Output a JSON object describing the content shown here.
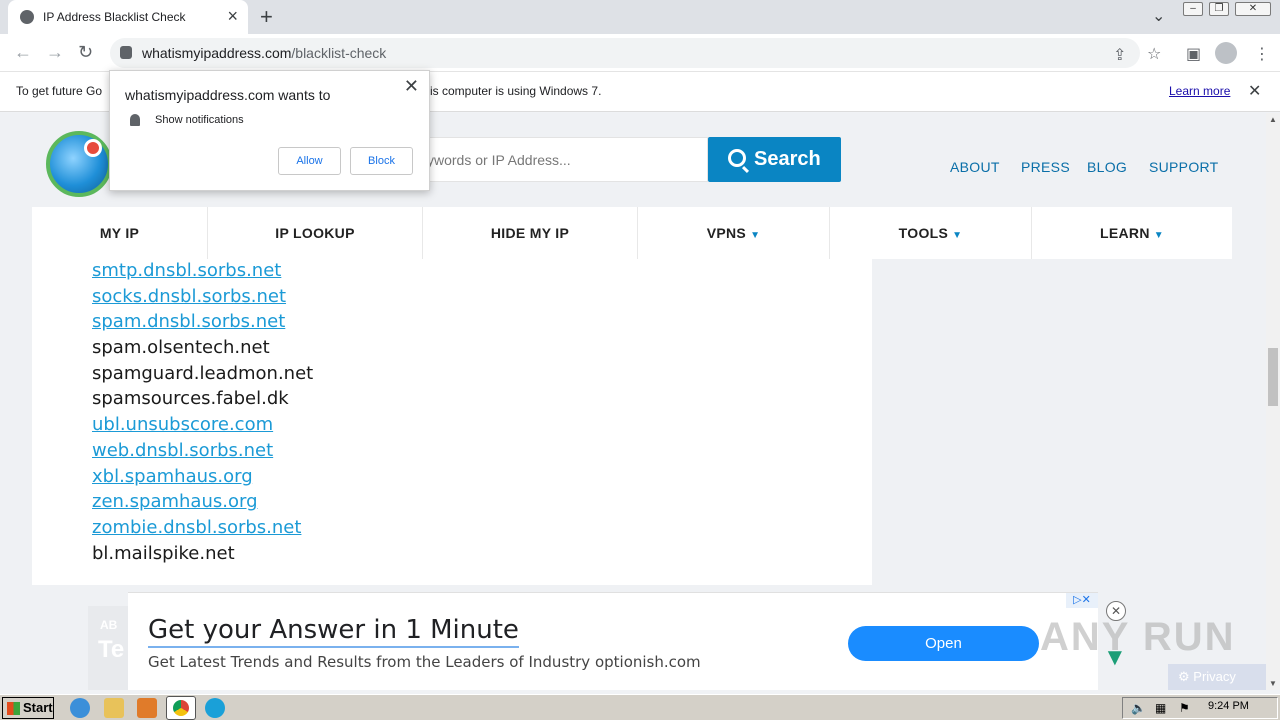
{
  "tab": {
    "title": "IP Address Blacklist Check",
    "favicon_icon": "globe-icon"
  },
  "address_bar": {
    "domain": "whatismyipaddress.com",
    "path": "/blacklist-check"
  },
  "infobar": {
    "message_left": "To get future Go",
    "message_right": "is computer is using Windows 7.",
    "learn_more": "Learn more"
  },
  "notification_prompt": {
    "heading": "whatismyipaddress.com wants to",
    "permission": "Show notifications",
    "allow": "Allow",
    "block": "Block"
  },
  "site": {
    "search_placeholder": "ywords or IP Address...",
    "search_button": "Search",
    "top_links": [
      "ABOUT",
      "PRESS",
      "BLOG",
      "SUPPORT"
    ],
    "nav": [
      {
        "label": "MY IP",
        "caret": ""
      },
      {
        "label": "IP LOOKUP",
        "caret": ""
      },
      {
        "label": "HIDE MY IP",
        "caret": ""
      },
      {
        "label": "VPNS",
        "caret": "▼"
      },
      {
        "label": "TOOLS",
        "caret": "▼"
      },
      {
        "label": "LEARN",
        "caret": "▼"
      }
    ],
    "blacklists": [
      {
        "name": "smtp.dnsbl.sorbs.net",
        "link": true
      },
      {
        "name": "socks.dnsbl.sorbs.net",
        "link": true
      },
      {
        "name": "spam.dnsbl.sorbs.net",
        "link": true
      },
      {
        "name": "spam.olsentech.net",
        "link": false
      },
      {
        "name": "spamguard.leadmon.net",
        "link": false
      },
      {
        "name": "spamsources.fabel.dk",
        "link": false
      },
      {
        "name": "ubl.unsubscore.com",
        "link": true
      },
      {
        "name": "web.dnsbl.sorbs.net",
        "link": true
      },
      {
        "name": "xbl.spamhaus.org",
        "link": true
      },
      {
        "name": "zen.spamhaus.org",
        "link": true
      },
      {
        "name": "zombie.dnsbl.sorbs.net",
        "link": true
      },
      {
        "name": "bl.mailspike.net",
        "link": false
      }
    ]
  },
  "ad": {
    "headline": "Get your Answer in 1 Minute",
    "subtext": "Get Latest Trends and Results from the Leaders of Industry optionish.com",
    "cta": "Open",
    "side_text_1": "AB",
    "side_text_2": "Te",
    "privacy": "Privacy",
    "adchoices": "▷✕"
  },
  "watermark": "ANY RUN",
  "taskbar": {
    "start": "Start",
    "clock": "9:24 PM"
  },
  "colors": {
    "brand_blue": "#0a85c3",
    "link_blue": "#1b9ad6",
    "ad_button": "#1a8cff"
  }
}
